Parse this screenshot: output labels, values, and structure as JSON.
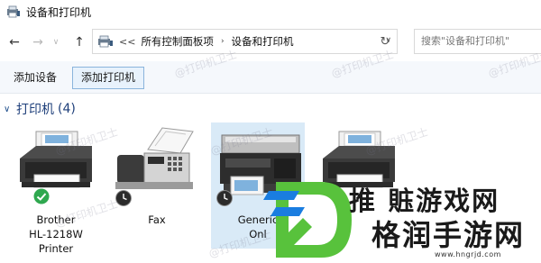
{
  "window": {
    "title": "设备和打印机"
  },
  "nav": {
    "back_icon": "arrow-left-icon",
    "forward_icon": "arrow-right-icon",
    "recent_icon": "chevron-down-icon",
    "up_icon": "arrow-up-icon",
    "refresh_icon": "refresh-icon"
  },
  "address": {
    "overflow": "<<",
    "crumbs": [
      "所有控制面板项",
      "设备和打印机"
    ]
  },
  "search": {
    "placeholder": "搜索\"设备和打印机\""
  },
  "commands": {
    "add_device": "添加设备",
    "add_printer": "添加打印机"
  },
  "group": {
    "title": "打印机",
    "count": "(4)"
  },
  "printers": [
    {
      "line1": "Brother",
      "line2": "HL-1218W",
      "line3": "Printer",
      "status": "default-check"
    },
    {
      "line1": "Fax",
      "line2": "",
      "line3": "",
      "status": "clock"
    },
    {
      "line1": "Generic",
      "line2": "Onl",
      "line3": "",
      "status": "clock"
    },
    {
      "line1": "",
      "line2": "",
      "line3": "",
      "status": ""
    }
  ],
  "watermark": {
    "text": "@打印机卫士"
  },
  "overlay": {
    "top_text": "推 賘游戏网",
    "main_text": "格润手游网",
    "url": "www.hngrjd.com"
  },
  "colors": {
    "accent_blue": "#1e3f7a",
    "selected_bg": "#d9eaf7",
    "check_green": "#2fa84f",
    "logo_green": "#58c23c",
    "logo_blue": "#1a7de0"
  }
}
